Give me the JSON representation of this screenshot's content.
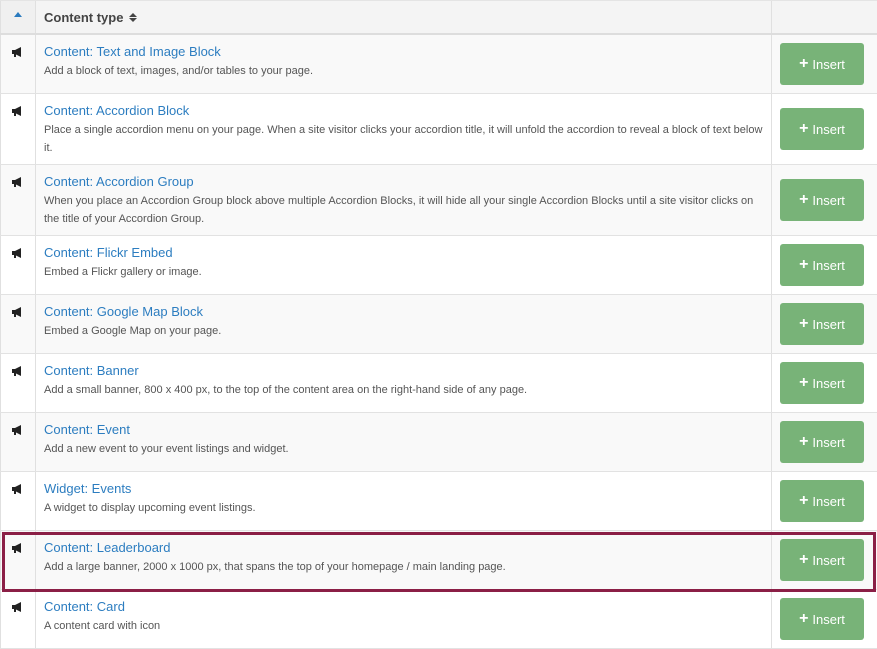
{
  "header": {
    "column_label": "Content type"
  },
  "insert_label": "Insert",
  "rows": [
    {
      "title": "Content: Text and Image Block",
      "description": "Add a block of text, images, and/or tables to your page."
    },
    {
      "title": "Content: Accordion Block",
      "description": "Place a single accordion menu on your page. When a site visitor clicks your accordion title, it will unfold the accordion to reveal a block of text below it."
    },
    {
      "title": "Content: Accordion Group",
      "description": "When you place an Accordion Group block above multiple Accordion Blocks, it will hide all your single Accordion Blocks until a site visitor clicks on the title of your Accordion Group."
    },
    {
      "title": "Content: Flickr Embed",
      "description": "Embed a Flickr gallery or image."
    },
    {
      "title": "Content: Google Map Block",
      "description": "Embed a Google Map on your page."
    },
    {
      "title": "Content: Banner",
      "description": "Add a small banner, 800 x 400 px, to the top of the content area on the right-hand side of any page."
    },
    {
      "title": "Content: Event",
      "description": "Add a new event to your event listings and widget."
    },
    {
      "title": "Widget: Events",
      "description": "A widget to display upcoming event listings."
    },
    {
      "title": "Content: Leaderboard",
      "description": "Add a large banner, 2000 x 1000 px, that spans the top of your homepage / main landing page."
    },
    {
      "title": "Content: Card",
      "description": "A content card with icon"
    }
  ],
  "colors": {
    "link": "#2c7dc0",
    "insert_button": "#78b378",
    "highlight": "#8b1f46"
  }
}
